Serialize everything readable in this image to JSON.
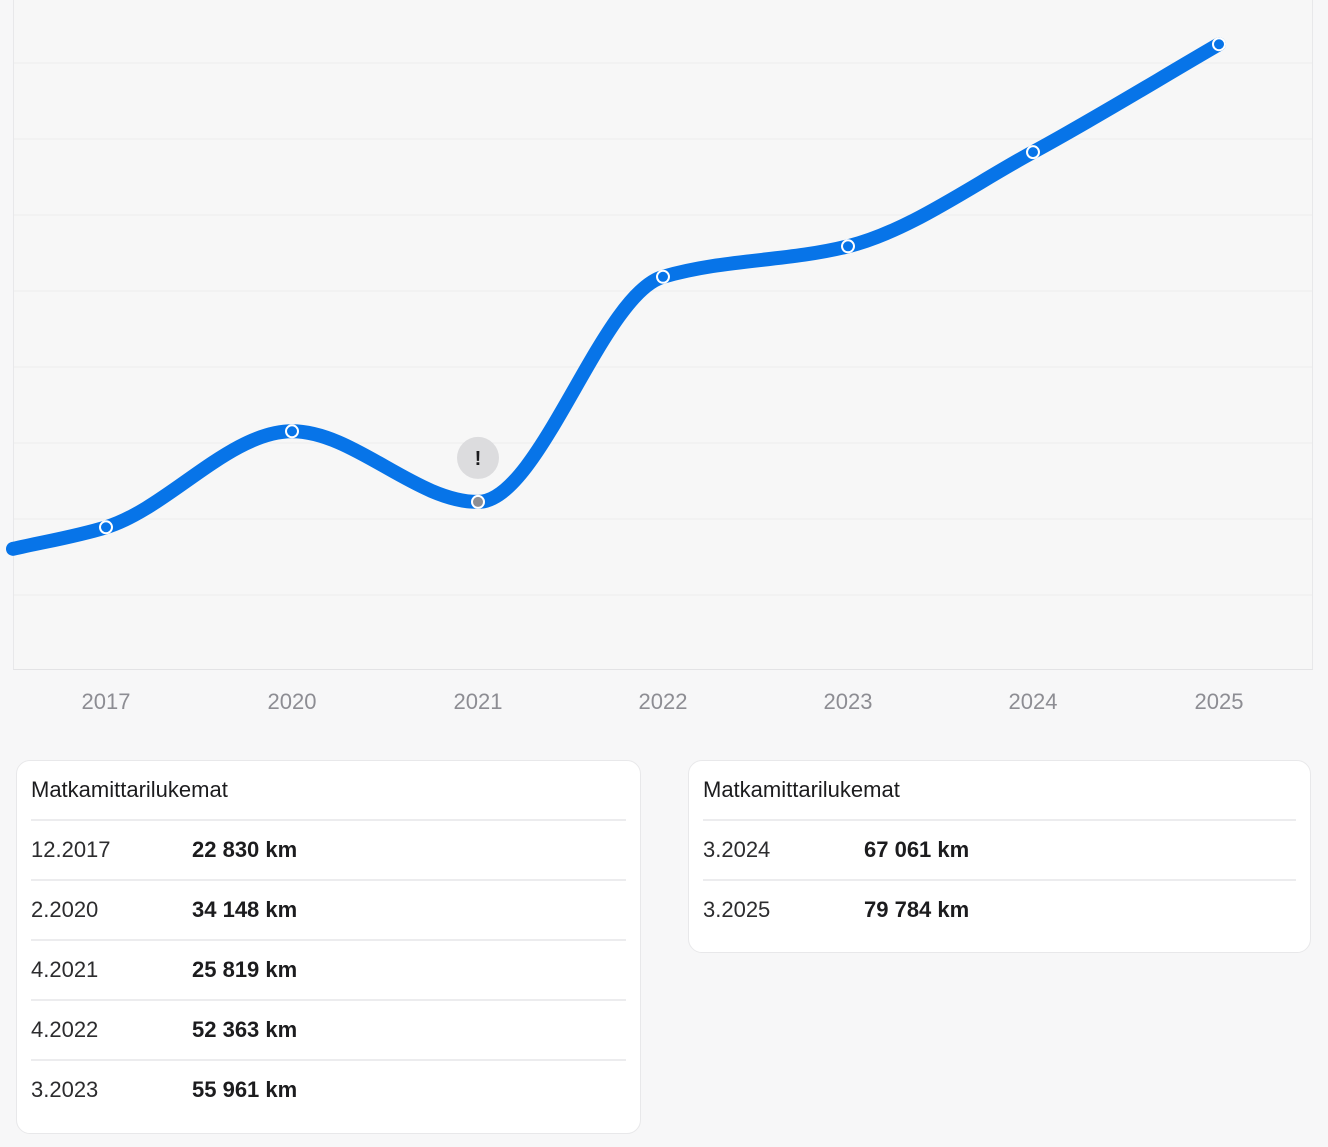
{
  "chart_data": {
    "type": "line",
    "categories": [
      "2017",
      "2020",
      "2021",
      "2022",
      "2023",
      "2024",
      "2025"
    ],
    "series": [
      {
        "values": [
          22830,
          34148,
          25819,
          52363,
          55961,
          67061,
          79784
        ]
      }
    ],
    "warning_marker": {
      "category": "2021",
      "symbol": "!"
    },
    "ylim": [
      6000,
      85000
    ],
    "grid": true,
    "line_color": "#0774e8",
    "warning_point_color": "#8e8e93",
    "warning_badge_color": "#dcdcde"
  },
  "cards": [
    {
      "title": "Matkamittarilukemat",
      "rows": [
        {
          "date": "12.2017",
          "km": "22 830 km"
        },
        {
          "date": "2.2020",
          "km": "34 148 km"
        },
        {
          "date": "4.2021",
          "km": "25 819 km"
        },
        {
          "date": "4.2022",
          "km": "52 363 km"
        },
        {
          "date": "3.2023",
          "km": "55 961 km"
        }
      ]
    },
    {
      "title": "Matkamittarilukemat",
      "rows": [
        {
          "date": "3.2024",
          "km": "67 061 km"
        },
        {
          "date": "3.2025",
          "km": "79 784 km"
        }
      ]
    }
  ]
}
